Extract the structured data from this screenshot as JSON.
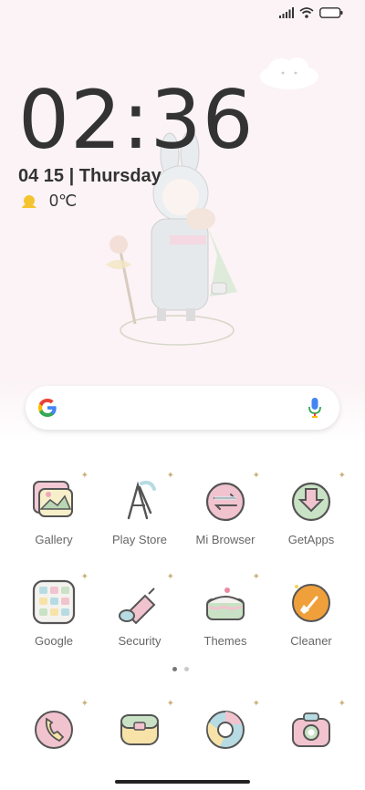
{
  "clock": {
    "time": "02:36"
  },
  "date": {
    "text": "04 15 | Thursday"
  },
  "weather": {
    "temperature": "0℃",
    "icon": "weather-sun-cloud-icon"
  },
  "status_bar": {
    "icons": [
      "signal-icon",
      "wifi-icon",
      "battery-icon"
    ]
  },
  "apps": [
    {
      "label": "Gallery",
      "icon": "gallery-icon"
    },
    {
      "label": "Play Store",
      "icon": "play-store-icon"
    },
    {
      "label": "Mi Browser",
      "icon": "mi-browser-icon"
    },
    {
      "label": "GetApps",
      "icon": "getapps-icon"
    },
    {
      "label": "Google",
      "icon": "google-folder-icon"
    },
    {
      "label": "Security",
      "icon": "security-icon"
    },
    {
      "label": "Themes",
      "icon": "themes-icon"
    },
    {
      "label": "Cleaner",
      "icon": "cleaner-icon"
    }
  ],
  "dock": [
    {
      "icon": "phone-icon"
    },
    {
      "icon": "messages-icon"
    },
    {
      "icon": "chrome-icon"
    },
    {
      "icon": "camera-icon"
    }
  ],
  "page_indicator": {
    "pages": 2,
    "active": 1
  },
  "colors": {
    "wallpaper_pink": "#fbf3f5",
    "text_dark": "#333333",
    "label_gray": "#666666"
  }
}
